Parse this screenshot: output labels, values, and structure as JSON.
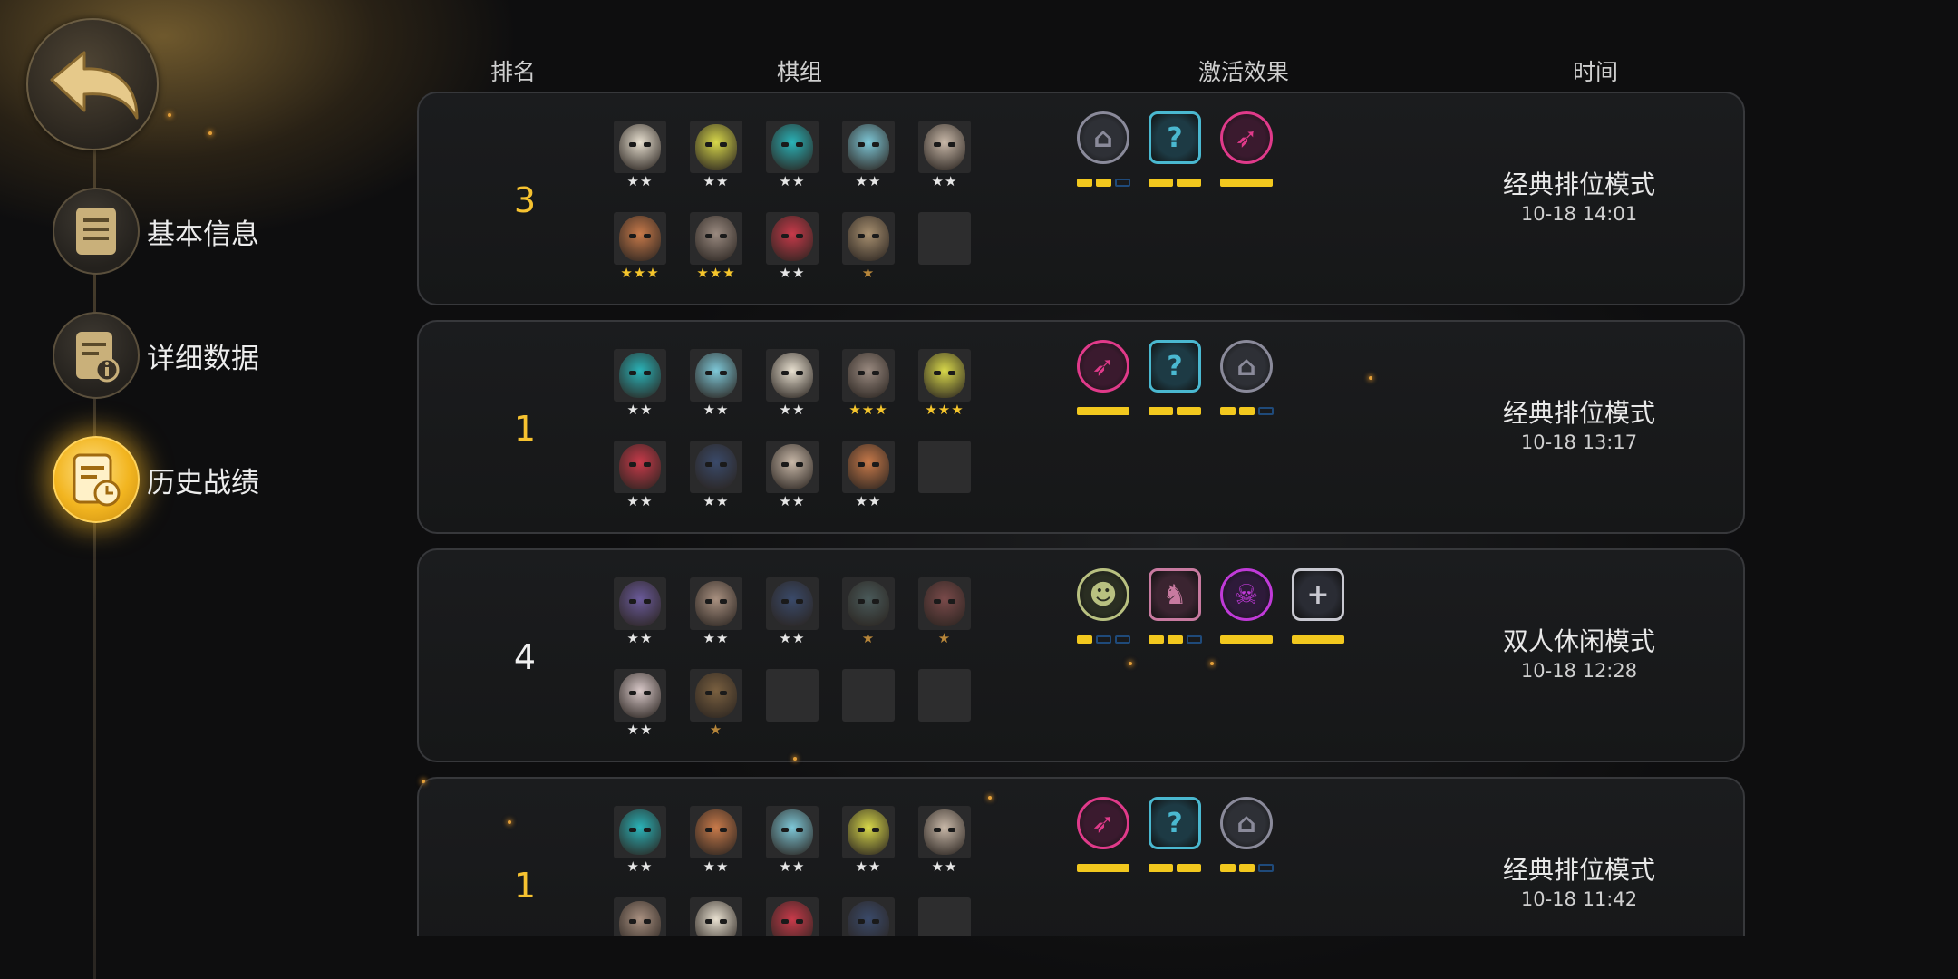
{
  "headers": {
    "rank": "排名",
    "board": "棋组",
    "effects": "激活效果",
    "time": "时间"
  },
  "sidebar": {
    "back": "back",
    "items": [
      {
        "label": "基本信息",
        "icon": "document-icon"
      },
      {
        "label": "详细数据",
        "icon": "stats-info-icon"
      },
      {
        "label": "历史战绩",
        "icon": "history-clock-icon"
      }
    ]
  },
  "colors": {
    "accent": "#f6c230",
    "gold": "#f2c81e"
  },
  "matches": [
    {
      "rank": "3",
      "rank_color": "gold",
      "mode": "经典排位模式",
      "time": "10-18 14:01",
      "pieces": [
        [
          "#e8e0d0",
          2
        ],
        [
          "#d8d84a",
          2
        ],
        [
          "#2ab3b8",
          2
        ],
        [
          "#7ec8d8",
          2
        ],
        [
          "#c8b8a8",
          2
        ],
        [
          "#c87a4a",
          3
        ],
        [
          "#9a8a80",
          3
        ],
        [
          "#c83a4a",
          2
        ],
        [
          "#a89070",
          1
        ],
        [
          null,
          0
        ]
      ],
      "synergies": [
        {
          "icon": "wizard-hat-icon",
          "color": "#8a8a9a",
          "bg": "#2e3036",
          "on": 2,
          "off": 1,
          "cls": false
        },
        {
          "icon": "question-shield-icon",
          "color": "#4ab8d0",
          "bg": "#1d3a44",
          "on": 2,
          "off": 0,
          "cls": true
        },
        {
          "icon": "demon-wing-icon",
          "color": "#e03a8a",
          "bg": "#3a1a2e",
          "on": 1,
          "off": 0,
          "cls": false
        }
      ]
    },
    {
      "rank": "1",
      "rank_color": "gold",
      "mode": "经典排位模式",
      "time": "10-18 13:17",
      "pieces": [
        [
          "#2ab3b8",
          2
        ],
        [
          "#7ec8d8",
          2
        ],
        [
          "#e8e0d0",
          2
        ],
        [
          "#9a8a80",
          3
        ],
        [
          "#d8d84a",
          3
        ],
        [
          "#c83a4a",
          2
        ],
        [
          "#3a4a6a",
          2
        ],
        [
          "#c8b8a8",
          2
        ],
        [
          "#c87a4a",
          2
        ],
        [
          null,
          0
        ]
      ],
      "synergies": [
        {
          "icon": "demon-wing-icon",
          "color": "#e03a8a",
          "bg": "#3a1a2e",
          "on": 1,
          "off": 0,
          "cls": false
        },
        {
          "icon": "question-shield-icon",
          "color": "#4ab8d0",
          "bg": "#1d3a44",
          "on": 2,
          "off": 0,
          "cls": true
        },
        {
          "icon": "wizard-hat-icon",
          "color": "#8a8a9a",
          "bg": "#2e3036",
          "on": 2,
          "off": 1,
          "cls": false
        }
      ]
    },
    {
      "rank": "4",
      "rank_color": "white",
      "mode": "双人休闲模式",
      "time": "10-18 12:28",
      "pieces": [
        [
          "#6a5a9a",
          2
        ],
        [
          "#a89080",
          2
        ],
        [
          "#3a4a6a",
          2
        ],
        [
          "#4a5a5a",
          1
        ],
        [
          "#7a4a4a",
          1
        ],
        [
          "#d8c8c8",
          2
        ],
        [
          "#7a6040",
          1
        ],
        [
          null,
          0
        ],
        [
          null,
          0
        ],
        [
          null,
          0
        ]
      ],
      "synergies": [
        {
          "icon": "goblin-icon",
          "color": "#b8c080",
          "bg": "#2a2e22",
          "on": 1,
          "off": 2,
          "cls": false
        },
        {
          "icon": "knight-icon",
          "color": "#c87aa0",
          "bg": "#3a2430",
          "on": 2,
          "off": 1,
          "cls": true
        },
        {
          "icon": "demon-face-icon",
          "color": "#c03ad8",
          "bg": "#2e1a3a",
          "on": 1,
          "off": 0,
          "cls": false
        },
        {
          "icon": "cross-icon",
          "color": "#c8c8d0",
          "bg": "#2a2c34",
          "on": 1,
          "off": 0,
          "cls": true
        }
      ]
    },
    {
      "rank": "1",
      "rank_color": "gold",
      "mode": "经典排位模式",
      "time": "10-18 11:42",
      "pieces": [
        [
          "#2ab3b8",
          2
        ],
        [
          "#c87a4a",
          2
        ],
        [
          "#7ec8d8",
          2
        ],
        [
          "#d8d84a",
          2
        ],
        [
          "#c8b8a8",
          2
        ],
        [
          "#a89080",
          0
        ],
        [
          "#e8e0d0",
          0
        ],
        [
          "#c83a4a",
          0
        ],
        [
          "#3a4a6a",
          0
        ],
        [
          null,
          0
        ]
      ],
      "synergies": [
        {
          "icon": "demon-wing-icon",
          "color": "#e03a8a",
          "bg": "#3a1a2e",
          "on": 1,
          "off": 0,
          "cls": false
        },
        {
          "icon": "question-shield-icon",
          "color": "#4ab8d0",
          "bg": "#1d3a44",
          "on": 2,
          "off": 0,
          "cls": true
        },
        {
          "icon": "wizard-hat-icon",
          "color": "#8a8a9a",
          "bg": "#2e3036",
          "on": 2,
          "off": 1,
          "cls": false
        }
      ]
    }
  ]
}
